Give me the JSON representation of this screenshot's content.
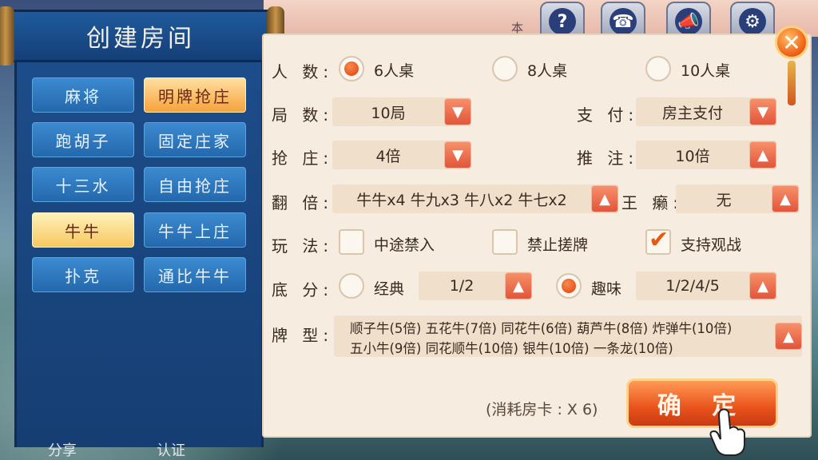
{
  "header": {
    "room_label": "本"
  },
  "left": {
    "title": "创建房间",
    "games": [
      {
        "label": "麻将",
        "style": "blue"
      },
      {
        "label": "明牌抢庄",
        "style": "orange"
      },
      {
        "label": "跑胡子",
        "style": "blue"
      },
      {
        "label": "固定庄家",
        "style": "blue"
      },
      {
        "label": "十三水",
        "style": "blue"
      },
      {
        "label": "自由抢庄",
        "style": "blue"
      },
      {
        "label": "牛牛",
        "style": "gold"
      },
      {
        "label": "牛牛上庄",
        "style": "blue"
      },
      {
        "label": "扑克",
        "style": "blue"
      },
      {
        "label": "通比牛牛",
        "style": "blue"
      }
    ],
    "bottom_tabs": [
      "分享",
      "认证"
    ]
  },
  "top_icons": [
    "help-icon",
    "telephone-icon",
    "megaphone-icon",
    "gear-icon"
  ],
  "form": {
    "players": {
      "label": "人 数:",
      "options": [
        "6人桌",
        "8人桌",
        "10人桌"
      ],
      "selected": 0
    },
    "rounds": {
      "label": "局 数:",
      "value": "10局"
    },
    "payment": {
      "label": "支 付:",
      "value": "房主支付"
    },
    "grab": {
      "label": "抢 庄:",
      "value": "4倍"
    },
    "push": {
      "label": "推 注:",
      "value": "10倍"
    },
    "double": {
      "label": "翻 倍:",
      "value": "牛牛x4 牛九x3 牛八x2 牛七x2"
    },
    "wild": {
      "label": "王 癞:",
      "value": "无"
    },
    "play": {
      "label": "玩 法:",
      "options": [
        {
          "label": "中途禁入",
          "checked": false
        },
        {
          "label": "禁止搓牌",
          "checked": false
        },
        {
          "label": "支持观战",
          "checked": true
        }
      ]
    },
    "base": {
      "label": "底 分:",
      "classic_label": "经典",
      "classic_value": "1/2",
      "fun_label": "趣味",
      "fun_value": "1/2/4/5",
      "selected": "fun"
    },
    "types": {
      "label": "牌 型:",
      "line1": "顺子牛(5倍) 五花牛(7倍) 同花牛(6倍) 葫芦牛(8倍) 炸弹牛(10倍)",
      "line2": "五小牛(9倍) 同花顺牛(10倍) 银牛(10倍) 一条龙(10倍)"
    }
  },
  "footer": {
    "cost": "(消耗房卡 : X 6)",
    "confirm": "确 定"
  },
  "colors": {
    "accent": "#e9531c",
    "panel_blue": "#1d4e8c",
    "parchment": "#f6ece0"
  }
}
